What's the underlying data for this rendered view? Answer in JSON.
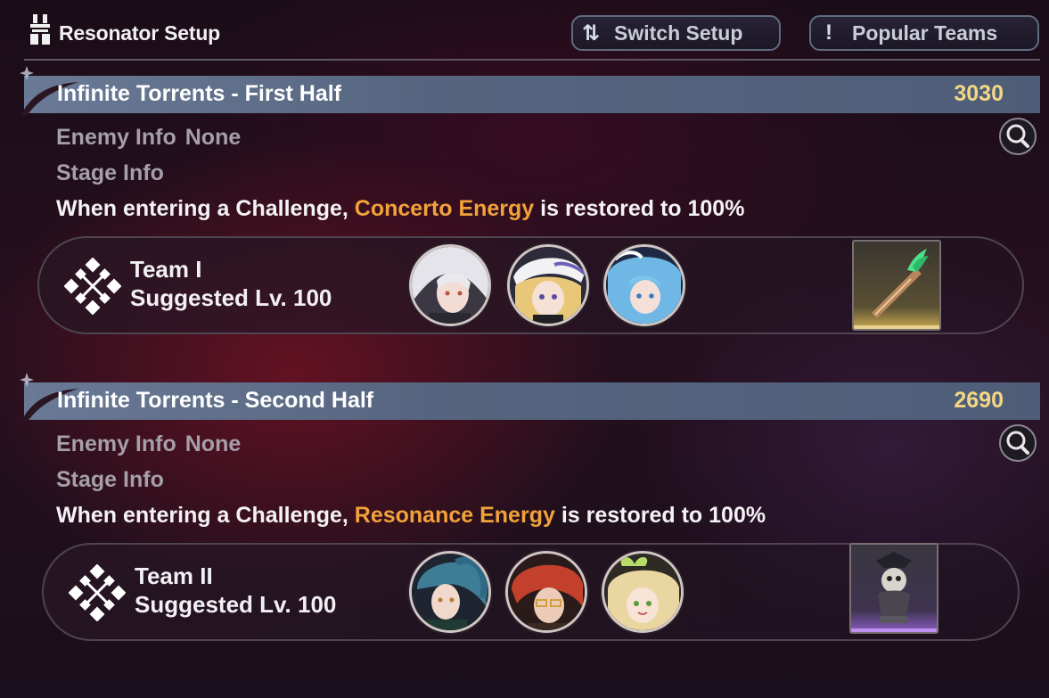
{
  "header": {
    "title": "Resonator Setup",
    "switch_button": {
      "icon": "swap-arrows-icon",
      "label": "Switch Setup"
    },
    "popular_button": {
      "icon": "exclamation-icon",
      "label": "Popular Teams"
    }
  },
  "sections": [
    {
      "title": "Infinite Torrents - First Half",
      "score": "3030",
      "enemy_info_label": "Enemy Info",
      "enemy_info_value": "None",
      "stage_info_label": "Stage Info",
      "stage_desc_before": "When entering a Challenge,",
      "stage_desc_highlight": "Concerto Energy",
      "stage_desc_after": "is restored to 100%",
      "team": {
        "name": "Team I",
        "level": "Suggested Lv. 100",
        "members": [
          "silver-hair-resonator-avatar",
          "blonde-hat-resonator-avatar",
          "blue-hair-resonator-avatar"
        ],
        "echo": "green-flame-sword-echo"
      }
    },
    {
      "title": "Infinite Torrents - Second Half",
      "score": "2690",
      "enemy_info_label": "Enemy Info",
      "enemy_info_value": "None",
      "stage_info_label": "Stage Info",
      "stage_desc_before": "When entering a Challenge,",
      "stage_desc_highlight": "Resonance Energy",
      "stage_desc_after": "is restored to 100%",
      "team": {
        "name": "Team II",
        "level": "Suggested Lv. 100",
        "members": [
          "teal-ponytail-resonator-avatar",
          "red-hair-glasses-resonator-avatar",
          "blonde-bow-resonator-avatar"
        ],
        "echo": "skull-captain-echo"
      }
    }
  ],
  "colors": {
    "highlight": "#f2a23a",
    "score": "#f3d784",
    "section_bar": "#5a6985"
  }
}
